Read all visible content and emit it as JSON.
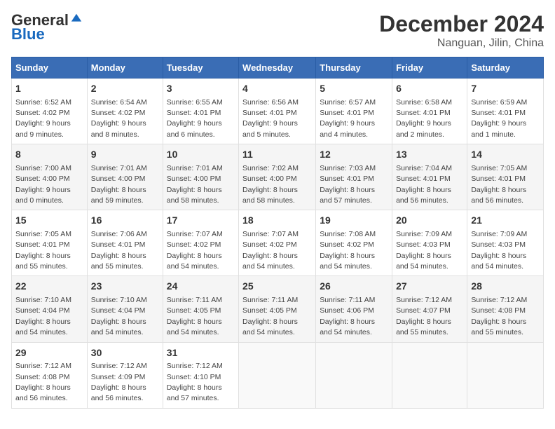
{
  "header": {
    "logo_general": "General",
    "logo_blue": "Blue",
    "month_title": "December 2024",
    "location": "Nanguan, Jilin, China"
  },
  "days_of_week": [
    "Sunday",
    "Monday",
    "Tuesday",
    "Wednesday",
    "Thursday",
    "Friday",
    "Saturday"
  ],
  "weeks": [
    [
      {
        "day": "1",
        "sunrise": "6:52 AM",
        "sunset": "4:02 PM",
        "daylight": "9 hours and 9 minutes."
      },
      {
        "day": "2",
        "sunrise": "6:54 AM",
        "sunset": "4:02 PM",
        "daylight": "9 hours and 8 minutes."
      },
      {
        "day": "3",
        "sunrise": "6:55 AM",
        "sunset": "4:01 PM",
        "daylight": "9 hours and 6 minutes."
      },
      {
        "day": "4",
        "sunrise": "6:56 AM",
        "sunset": "4:01 PM",
        "daylight": "9 hours and 5 minutes."
      },
      {
        "day": "5",
        "sunrise": "6:57 AM",
        "sunset": "4:01 PM",
        "daylight": "9 hours and 4 minutes."
      },
      {
        "day": "6",
        "sunrise": "6:58 AM",
        "sunset": "4:01 PM",
        "daylight": "9 hours and 2 minutes."
      },
      {
        "day": "7",
        "sunrise": "6:59 AM",
        "sunset": "4:01 PM",
        "daylight": "9 hours and 1 minute."
      }
    ],
    [
      {
        "day": "8",
        "sunrise": "7:00 AM",
        "sunset": "4:00 PM",
        "daylight": "9 hours and 0 minutes."
      },
      {
        "day": "9",
        "sunrise": "7:01 AM",
        "sunset": "4:00 PM",
        "daylight": "8 hours and 59 minutes."
      },
      {
        "day": "10",
        "sunrise": "7:01 AM",
        "sunset": "4:00 PM",
        "daylight": "8 hours and 58 minutes."
      },
      {
        "day": "11",
        "sunrise": "7:02 AM",
        "sunset": "4:00 PM",
        "daylight": "8 hours and 58 minutes."
      },
      {
        "day": "12",
        "sunrise": "7:03 AM",
        "sunset": "4:01 PM",
        "daylight": "8 hours and 57 minutes."
      },
      {
        "day": "13",
        "sunrise": "7:04 AM",
        "sunset": "4:01 PM",
        "daylight": "8 hours and 56 minutes."
      },
      {
        "day": "14",
        "sunrise": "7:05 AM",
        "sunset": "4:01 PM",
        "daylight": "8 hours and 56 minutes."
      }
    ],
    [
      {
        "day": "15",
        "sunrise": "7:05 AM",
        "sunset": "4:01 PM",
        "daylight": "8 hours and 55 minutes."
      },
      {
        "day": "16",
        "sunrise": "7:06 AM",
        "sunset": "4:01 PM",
        "daylight": "8 hours and 55 minutes."
      },
      {
        "day": "17",
        "sunrise": "7:07 AM",
        "sunset": "4:02 PM",
        "daylight": "8 hours and 54 minutes."
      },
      {
        "day": "18",
        "sunrise": "7:07 AM",
        "sunset": "4:02 PM",
        "daylight": "8 hours and 54 minutes."
      },
      {
        "day": "19",
        "sunrise": "7:08 AM",
        "sunset": "4:02 PM",
        "daylight": "8 hours and 54 minutes."
      },
      {
        "day": "20",
        "sunrise": "7:09 AM",
        "sunset": "4:03 PM",
        "daylight": "8 hours and 54 minutes."
      },
      {
        "day": "21",
        "sunrise": "7:09 AM",
        "sunset": "4:03 PM",
        "daylight": "8 hours and 54 minutes."
      }
    ],
    [
      {
        "day": "22",
        "sunrise": "7:10 AM",
        "sunset": "4:04 PM",
        "daylight": "8 hours and 54 minutes."
      },
      {
        "day": "23",
        "sunrise": "7:10 AM",
        "sunset": "4:04 PM",
        "daylight": "8 hours and 54 minutes."
      },
      {
        "day": "24",
        "sunrise": "7:11 AM",
        "sunset": "4:05 PM",
        "daylight": "8 hours and 54 minutes."
      },
      {
        "day": "25",
        "sunrise": "7:11 AM",
        "sunset": "4:05 PM",
        "daylight": "8 hours and 54 minutes."
      },
      {
        "day": "26",
        "sunrise": "7:11 AM",
        "sunset": "4:06 PM",
        "daylight": "8 hours and 54 minutes."
      },
      {
        "day": "27",
        "sunrise": "7:12 AM",
        "sunset": "4:07 PM",
        "daylight": "8 hours and 55 minutes."
      },
      {
        "day": "28",
        "sunrise": "7:12 AM",
        "sunset": "4:08 PM",
        "daylight": "8 hours and 55 minutes."
      }
    ],
    [
      {
        "day": "29",
        "sunrise": "7:12 AM",
        "sunset": "4:08 PM",
        "daylight": "8 hours and 56 minutes."
      },
      {
        "day": "30",
        "sunrise": "7:12 AM",
        "sunset": "4:09 PM",
        "daylight": "8 hours and 56 minutes."
      },
      {
        "day": "31",
        "sunrise": "7:12 AM",
        "sunset": "4:10 PM",
        "daylight": "8 hours and 57 minutes."
      },
      null,
      null,
      null,
      null
    ]
  ]
}
